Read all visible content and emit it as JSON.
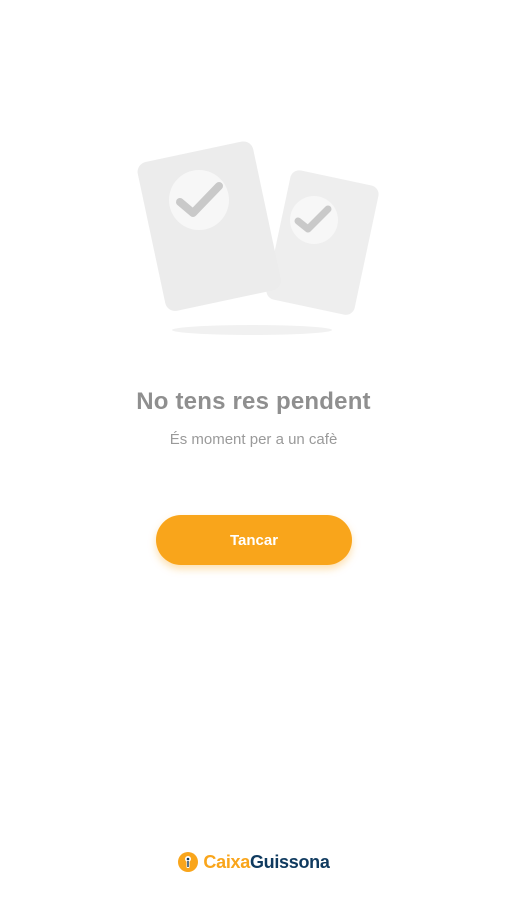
{
  "empty_state": {
    "title": "No tens res pendent",
    "subtitle": "És moment per a un cafè",
    "illustration_icon": "checked-documents-icon"
  },
  "actions": {
    "close_label": "Tancar"
  },
  "footer": {
    "brand_part_1": "Caixa",
    "brand_part_2": "Guissona",
    "logo_icon": "caixa-guissona-logo-icon"
  },
  "colors": {
    "accent": "#f9a51b",
    "brand_dark": "#0f3a5f",
    "text_muted": "#8f8f8f",
    "illustration_gray": "#eeeeee"
  }
}
